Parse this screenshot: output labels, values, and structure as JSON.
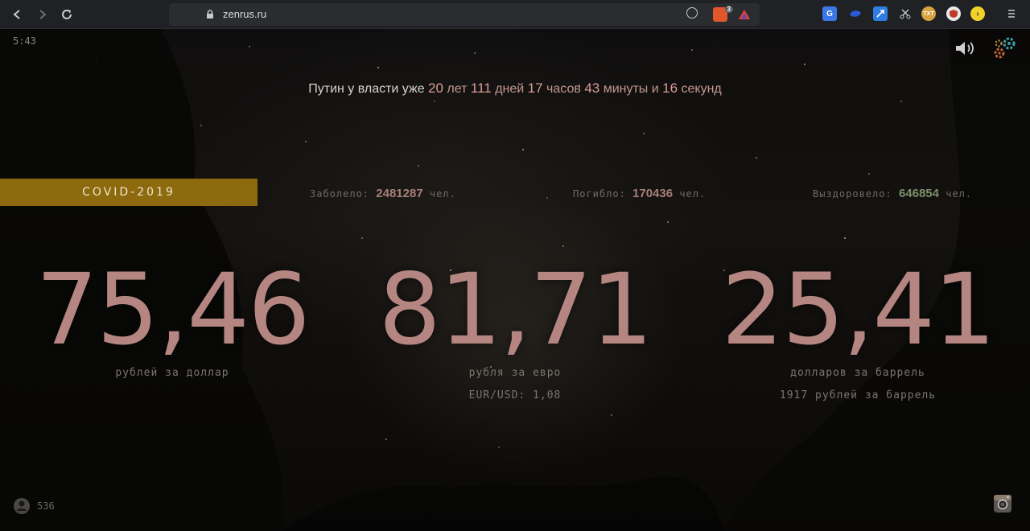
{
  "browser": {
    "url": "zenrus.ru",
    "brave_badge": "3"
  },
  "page": {
    "clock": "5:43",
    "putin": {
      "prefix": "Путин у власти уже",
      "years": "20",
      "years_unit": "лет",
      "days": "111",
      "days_unit": "дней",
      "hours": "17",
      "hours_unit": "часов",
      "minutes": "43",
      "minutes_unit": "минуты и",
      "seconds": "16",
      "seconds_unit": "секунд"
    },
    "covid": {
      "label": "COVID-2019",
      "infected_label": "Заболело:",
      "infected_value": "2481287",
      "infected_unit": "чел.",
      "died_label": "Погибло:",
      "died_value": "170436",
      "died_unit": "чел.",
      "recovered_label": "Выздоровело:",
      "recovered_value": "646854",
      "recovered_unit": "чел."
    },
    "rates": [
      {
        "value": "75,46",
        "caption": "рублей за доллар",
        "sub": ""
      },
      {
        "value": "81,71",
        "caption": "рубля за евро",
        "sub": "EUR/USD: 1,08"
      },
      {
        "value": "25,41",
        "caption": "долларов за баррель",
        "sub": "1917 рублей за баррель"
      }
    ],
    "visitors": "536"
  },
  "colors": {
    "accent_bar": "#8d6a0d",
    "rate_text": "#b48581",
    "recovered": "#7c8f6a"
  }
}
